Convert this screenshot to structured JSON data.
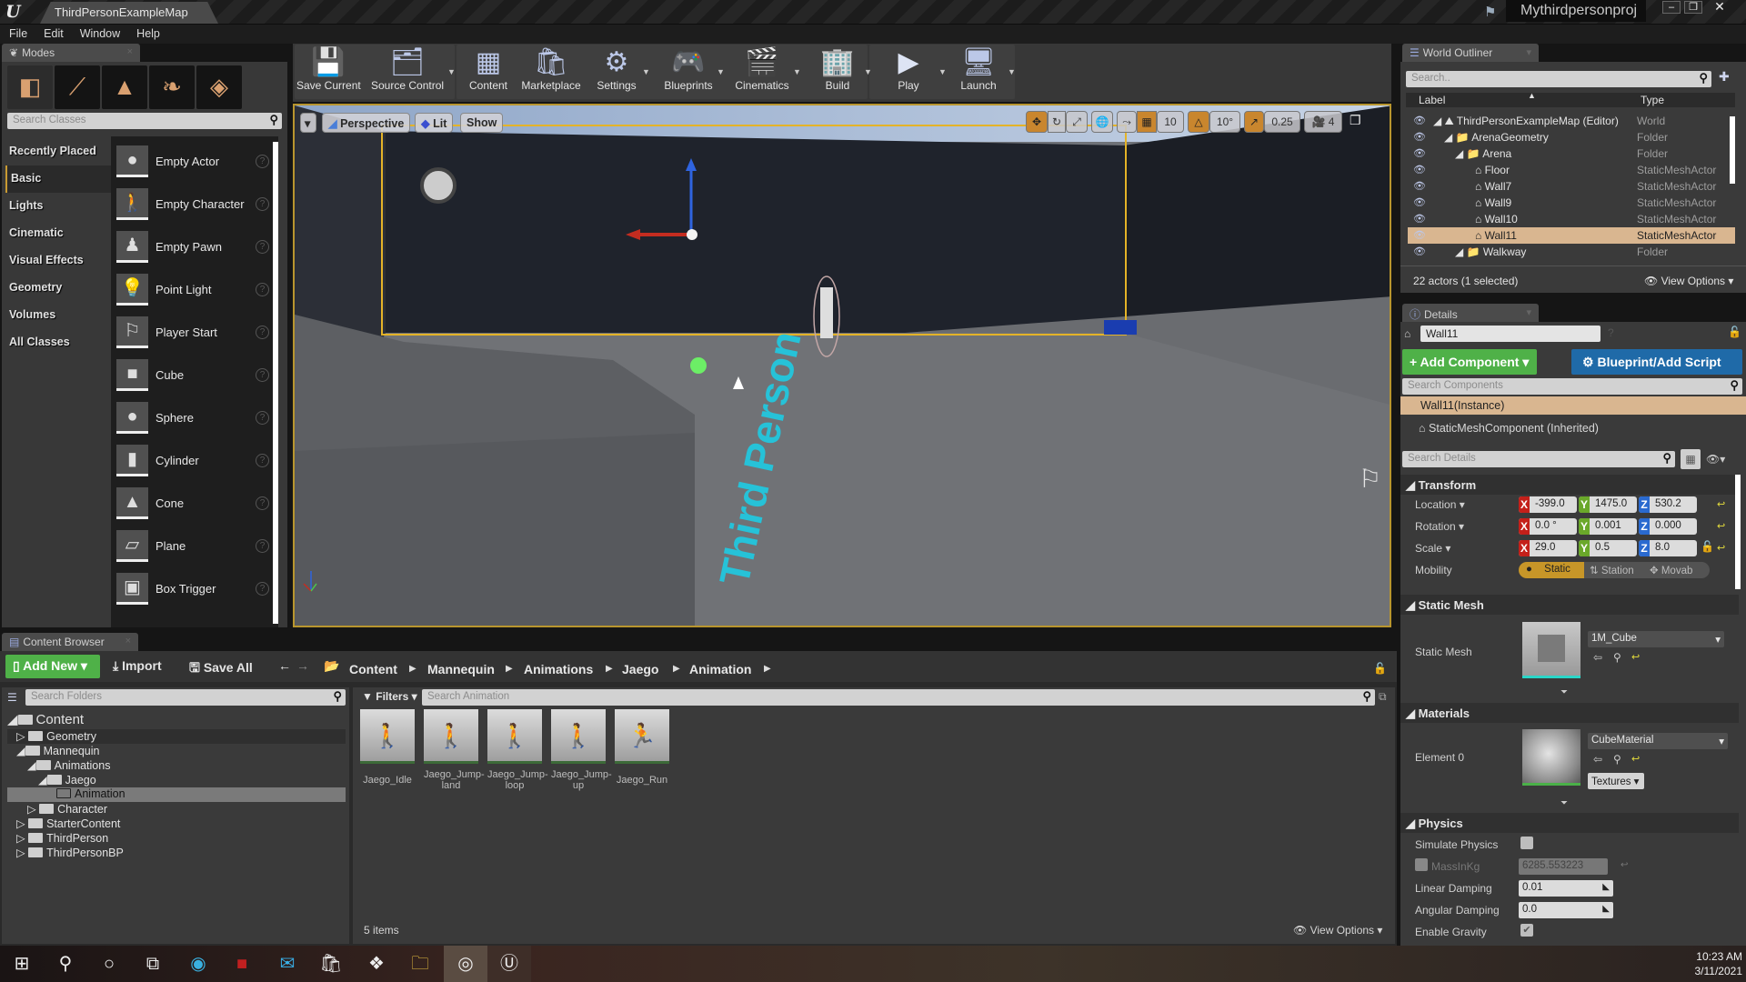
{
  "window": {
    "document_tab": "ThirdPersonExampleMap",
    "project_name": "Mythirdpersonproj",
    "controls": [
      "minimize",
      "restore",
      "close"
    ]
  },
  "menu": [
    "File",
    "Edit",
    "Window",
    "Help"
  ],
  "modes": {
    "tab_label": "Modes",
    "mode_buttons": [
      "place",
      "paint",
      "landscape",
      "foliage",
      "geometry-edit"
    ],
    "search_placeholder": "Search Classes",
    "categories": [
      "Recently Placed",
      "Basic",
      "Lights",
      "Cinematic",
      "Visual Effects",
      "Geometry",
      "Volumes",
      "All Classes"
    ],
    "selected_category": "Basic",
    "classes": [
      {
        "name": "Empty Actor",
        "icon": "sphere-icon"
      },
      {
        "name": "Empty Character",
        "icon": "character-icon"
      },
      {
        "name": "Empty Pawn",
        "icon": "pawn-icon"
      },
      {
        "name": "Point Light",
        "icon": "bulb-icon"
      },
      {
        "name": "Player Start",
        "icon": "player-start-icon"
      },
      {
        "name": "Cube",
        "icon": "cube-icon"
      },
      {
        "name": "Sphere",
        "icon": "sphere-icon"
      },
      {
        "name": "Cylinder",
        "icon": "cylinder-icon"
      },
      {
        "name": "Cone",
        "icon": "cone-icon"
      },
      {
        "name": "Plane",
        "icon": "plane-icon"
      },
      {
        "name": "Box Trigger",
        "icon": "box-trigger-icon"
      }
    ]
  },
  "toolbar": {
    "buttons": [
      {
        "label": "Save Current",
        "icon": "save-icon",
        "dropdown": false
      },
      {
        "label": "Source Control",
        "icon": "source-control-icon",
        "dropdown": true
      },
      {
        "label": "Content",
        "icon": "content-icon",
        "dropdown": false
      },
      {
        "label": "Marketplace",
        "icon": "marketplace-icon",
        "dropdown": false
      },
      {
        "label": "Settings",
        "icon": "settings-icon",
        "dropdown": true
      },
      {
        "label": "Blueprints",
        "icon": "blueprints-icon",
        "dropdown": true
      },
      {
        "label": "Cinematics",
        "icon": "cinematics-icon",
        "dropdown": true
      },
      {
        "label": "Build",
        "icon": "build-icon",
        "dropdown": true
      },
      {
        "label": "Play",
        "icon": "play-icon",
        "dropdown": true
      },
      {
        "label": "Launch",
        "icon": "launch-icon",
        "dropdown": true
      }
    ]
  },
  "viewport": {
    "view_mode": "Perspective",
    "lighting": "Lit",
    "show_label": "Show",
    "grid_snap": "10",
    "rotation_snap": "10°",
    "scale_snap": "0.25",
    "camera_speed": "4",
    "floor_text": "Third Person"
  },
  "world_outliner": {
    "tab_label": "World Outliner",
    "search_placeholder": "Search..",
    "columns": [
      "Label",
      "Type"
    ],
    "rows": [
      {
        "label": "ThirdPersonExampleMap (Editor)",
        "type": "World",
        "depth": 0,
        "expanded": true
      },
      {
        "label": "ArenaGeometry",
        "type": "Folder",
        "depth": 1,
        "expanded": true
      },
      {
        "label": "Arena",
        "type": "Folder",
        "depth": 2,
        "expanded": true
      },
      {
        "label": "Floor",
        "type": "StaticMeshActor",
        "depth": 3
      },
      {
        "label": "Wall7",
        "type": "StaticMeshActor",
        "depth": 3
      },
      {
        "label": "Wall9",
        "type": "StaticMeshActor",
        "depth": 3
      },
      {
        "label": "Wall10",
        "type": "StaticMeshActor",
        "depth": 3
      },
      {
        "label": "Wall11",
        "type": "StaticMeshActor",
        "depth": 3,
        "selected": true
      },
      {
        "label": "Walkway",
        "type": "Folder",
        "depth": 2,
        "expanded": true
      }
    ],
    "status": "22 actors (1 selected)",
    "view_options": "View Options"
  },
  "details": {
    "tab_label": "Details",
    "actor_name": "Wall11",
    "add_component": "+ Add Component",
    "blueprint_button": "Blueprint/Add Script",
    "search_components_placeholder": "Search Components",
    "components": [
      "Wall11(Instance)",
      "StaticMeshComponent (Inherited)"
    ],
    "search_details_placeholder": "Search Details",
    "transform": {
      "title": "Transform",
      "location_label": "Location",
      "rotation_label": "Rotation",
      "scale_label": "Scale",
      "mobility_label": "Mobility",
      "location": [
        "-399.0",
        "1475.0",
        "530.2"
      ],
      "rotation": [
        "0.0 °",
        "0.001",
        "0.000"
      ],
      "scale": [
        "29.0",
        "0.5",
        "8.0"
      ],
      "mobility_options": [
        "Static",
        "Station",
        "Movab"
      ],
      "mobility_selected": "Static"
    },
    "static_mesh": {
      "title": "Static Mesh",
      "label": "Static Mesh",
      "value": "1M_Cube"
    },
    "materials": {
      "title": "Materials",
      "label": "Element 0",
      "value": "CubeMaterial",
      "textures_button": "Textures"
    },
    "physics": {
      "title": "Physics",
      "simulate_label": "Simulate Physics",
      "simulate": false,
      "mass_label": "MassInKg",
      "mass_value": "6285.553223",
      "linear_label": "Linear Damping",
      "linear_value": "0.01",
      "angular_label": "Angular Damping",
      "angular_value": "0.0",
      "gravity_label": "Enable Gravity",
      "gravity": true
    }
  },
  "content_browser": {
    "tab_label": "Content Browser",
    "add_new": "Add New",
    "import": "Import",
    "save_all": "Save All",
    "breadcrumb": [
      "Content",
      "Mannequin",
      "Animations",
      "Jaego",
      "Animation"
    ],
    "search_folders_placeholder": "Search Folders",
    "filters": "Filters",
    "search_assets_placeholder": "Search Animation",
    "tree": [
      {
        "name": "Content",
        "depth": 0,
        "expanded": true
      },
      {
        "name": "Geometry",
        "depth": 1,
        "expanded": false
      },
      {
        "name": "Mannequin",
        "depth": 1,
        "expanded": true
      },
      {
        "name": "Animations",
        "depth": 2,
        "expanded": true
      },
      {
        "name": "Jaego",
        "depth": 3,
        "expanded": true
      },
      {
        "name": "Animation",
        "depth": 4,
        "selected": true
      },
      {
        "name": "Character",
        "depth": 2,
        "expanded": false
      },
      {
        "name": "StarterContent",
        "depth": 1,
        "expanded": false
      },
      {
        "name": "ThirdPerson",
        "depth": 1,
        "expanded": false
      },
      {
        "name": "ThirdPersonBP",
        "depth": 1,
        "expanded": false
      }
    ],
    "assets": [
      {
        "line1": "Jaego_Idle",
        "line2": ""
      },
      {
        "line1": "Jaego_Jump-",
        "line2": "land"
      },
      {
        "line1": "Jaego_Jump-",
        "line2": "loop"
      },
      {
        "line1": "Jaego_Jump-",
        "line2": "up"
      },
      {
        "line1": "Jaego_Run",
        "line2": ""
      }
    ],
    "item_count": "5 items",
    "view_options": "View Options"
  },
  "taskbar": {
    "apps": [
      "start",
      "search",
      "cortana",
      "task-view",
      "edge",
      "game-app",
      "mail",
      "store",
      "dropbox",
      "file-explorer",
      "obs",
      "unreal-engine"
    ],
    "time": "10:23 AM",
    "date": "3/11/2021"
  }
}
